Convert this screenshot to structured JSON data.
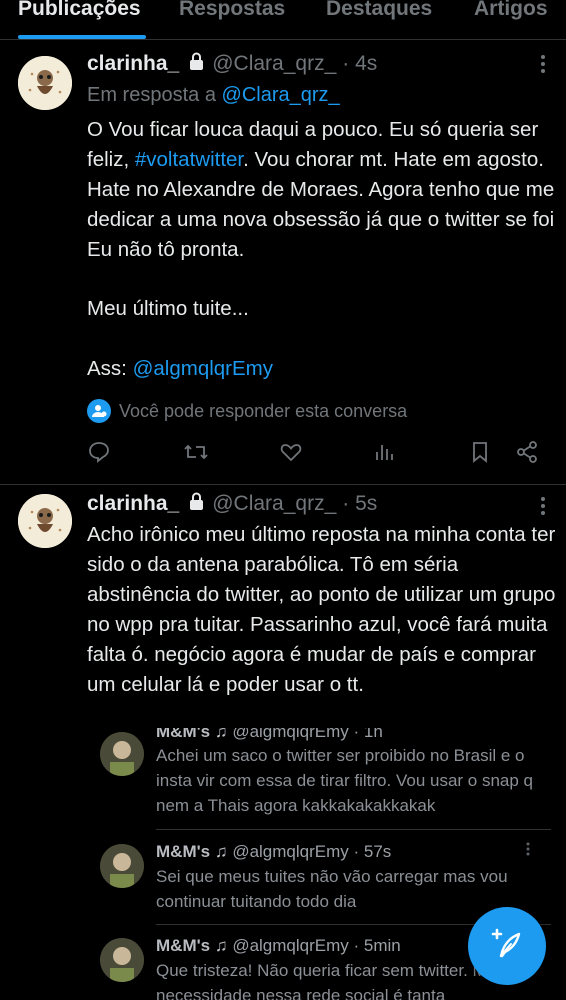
{
  "tabs": [
    {
      "label": "Publicações",
      "active": true
    },
    {
      "label": "Respostas",
      "active": false
    },
    {
      "label": "Destaques",
      "active": false
    },
    {
      "label": "Artigos",
      "active": false
    }
  ],
  "post1": {
    "name": "clarinha_",
    "handle": "@Clara_qrz_",
    "time": "· 4s",
    "reply_prefix": "Em resposta a",
    "reply_handle": "@Clara_qrz_",
    "text_a": "O  Vou ficar louca daqui a pouco. Eu só queria ser feliz,",
    "hashtag": "#voltatwitter",
    "text_b": ". Vou chorar mt. Hate em agosto. Hate no Alexandre de Moraes. Agora tenho que me dedicar a uma nova obsessão já que o twitter se foi Eu não tô pronta.",
    "text_c": "Meu último tuite...",
    "sign_prefix": "Ass:",
    "sign_handle": "@algmqlqrEmy",
    "conversation": "Você pode responder esta conversa"
  },
  "post2": {
    "name": "clarinha_",
    "handle": "@Clara_qrz_",
    "time": "· 5s",
    "text": "Acho irônico meu último reposta na minha conta ter sido o da antena parabólica. Tô em séria abstinência do twitter, ao ponto de utilizar um grupo no wpp pra tuitar. Passarinho azul, você fará muita falta ó. negócio agora é mudar de país e comprar um celular lá e poder usar o tt."
  },
  "replies": [
    {
      "name": "M&M's ♫",
      "handle": "@algmqlqrEmy",
      "time": "· 1h",
      "text": "Achei um saco o twitter ser proibido no Brasil e o insta vir com essa de tirar filtro. Vou usar o snap q nem a Thais agora kakkakakakkakak"
    },
    {
      "name": "M&M's ♫",
      "handle": "@algmqlqrEmy",
      "time": "· 57s",
      "text": "Sei que meus tuites não vão carregar mas vou continuar tuitando todo dia"
    },
    {
      "name": "M&M's ♫",
      "handle": "@algmqlqrEmy",
      "time": "· 5min",
      "text": "Que tristeza! Não queria ficar sem twitter. Minha necessidade nessa rede social é tanta"
    }
  ],
  "icons": {
    "more": "more-icon",
    "reply": "reply-icon",
    "retweet": "retweet-icon",
    "like": "heart-icon",
    "views": "views-icon",
    "bookmark": "bookmark-icon",
    "share": "share-icon",
    "compose": "compose-icon"
  },
  "colors": {
    "background": "#000000",
    "accent": "#1d9bf0",
    "text": "#e7e9ea",
    "muted": "#71767b"
  }
}
